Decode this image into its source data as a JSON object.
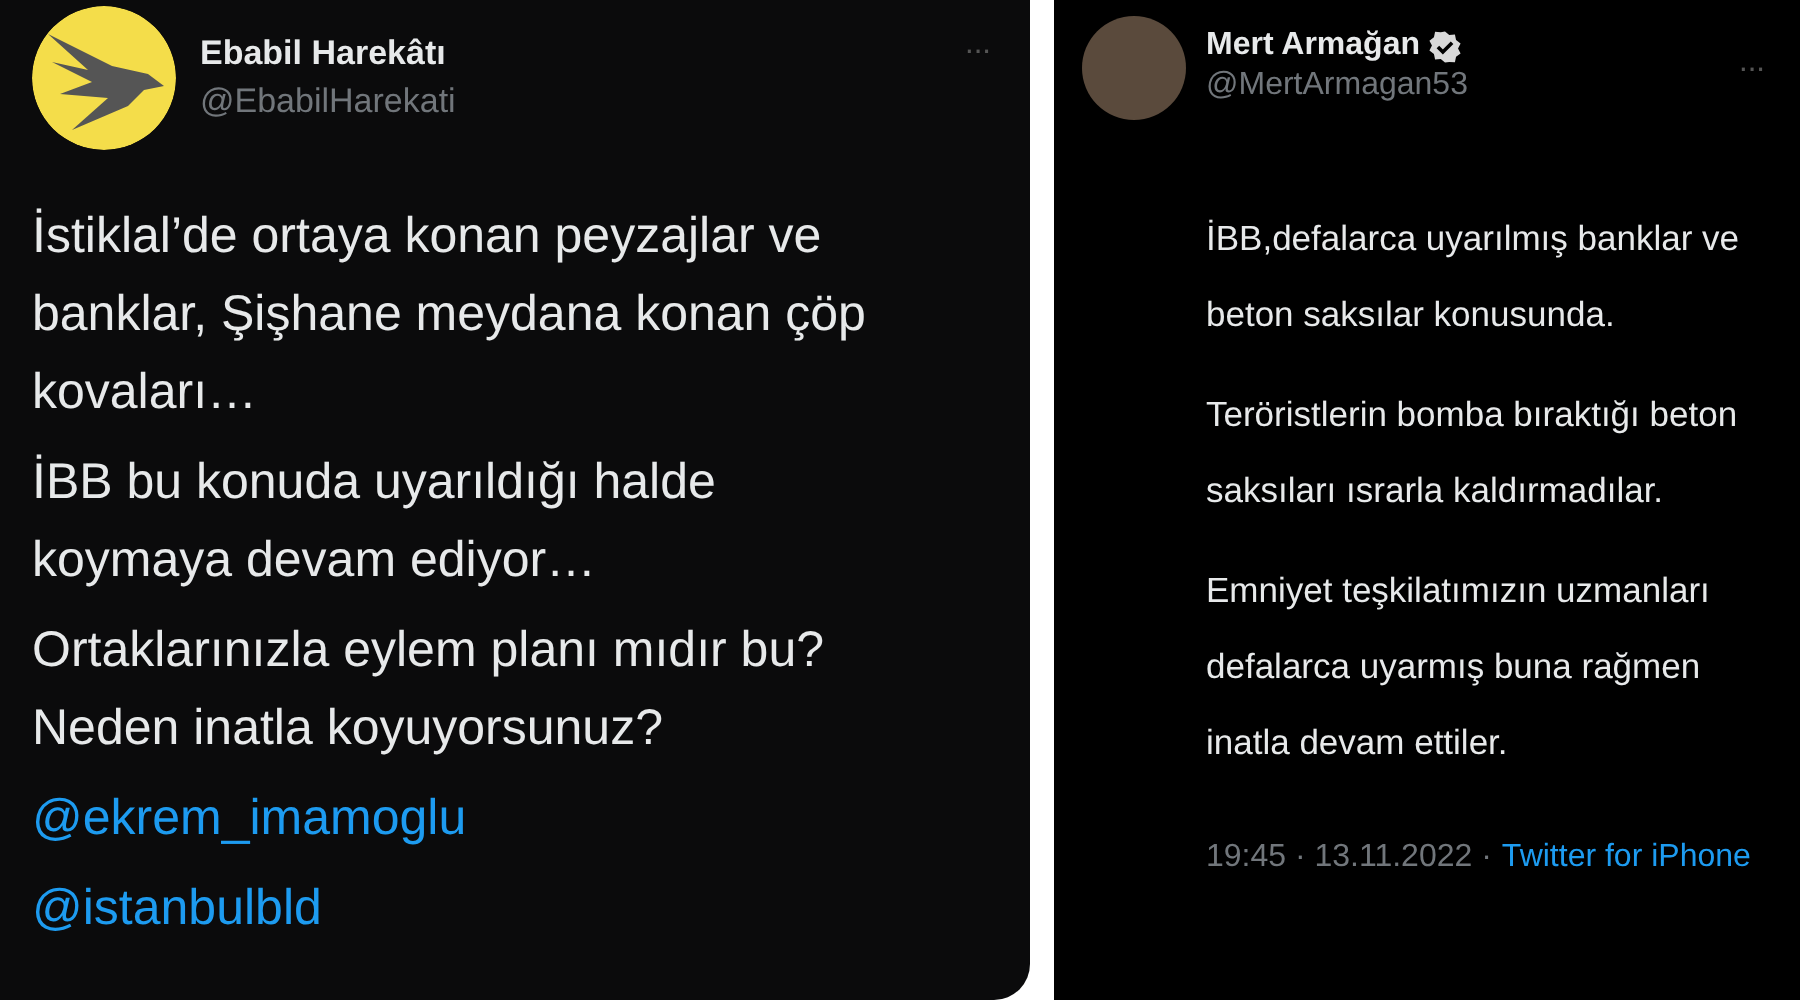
{
  "tweets": [
    {
      "author": {
        "name": "Ebabil Harekâtı",
        "handle": "@EbabilHarekati",
        "verified": false,
        "avatar": {
          "kind": "logo"
        }
      },
      "more": "···",
      "paragraphs": [
        "İstiklal’de ortaya konan peyzajlar ve\nbanklar, Şişhane meydana konan çöp\nkovaları…",
        "İBB bu konuda uyarıldığı halde\nkoymaya devam ediyor…",
        "Ortaklarınızla eylem planı mıdır bu?\nNeden inatla koyuyorsunuz?"
      ],
      "mentions": [
        "@ekrem_imamoglu",
        "@istanbulbld"
      ]
    },
    {
      "author": {
        "name": "Mert Armağan",
        "handle": "@MertArmagan53",
        "verified": true,
        "avatar": {
          "kind": "photo"
        }
      },
      "more": "···",
      "paragraphs": [
        "İBB,defalarca uyarılmış banklar ve\nbeton saksılar konusunda.",
        "Teröristlerin bomba bıraktığı beton\nsaksıları ısrarla kaldırmadılar.",
        "Emniyet teşkilatımızın uzmanları\ndefalarca uyarmış buna rağmen\ninatla devam ettiler."
      ],
      "footer": {
        "time": "19:45 · 13.11.2022 ·",
        "source": "Twitter for iPhone"
      }
    }
  ]
}
